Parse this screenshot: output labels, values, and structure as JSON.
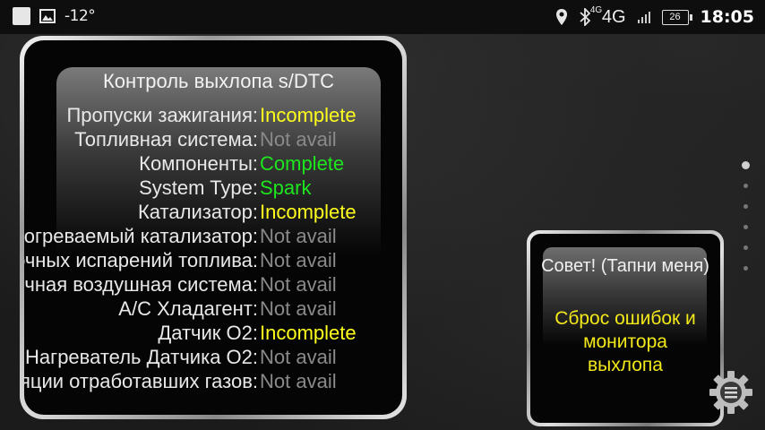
{
  "statusbar": {
    "temperature": "-12°",
    "network_small": "4G",
    "network": "4G",
    "battery": "26",
    "time": "18:05",
    "icons": [
      "square-icon",
      "image-icon",
      "location-icon",
      "bluetooth-icon",
      "signal-icon",
      "battery-icon"
    ]
  },
  "monitor": {
    "title": "Контроль выхлопа s/DTC",
    "rows": [
      {
        "label": "Пропуски зажигания:",
        "value": "Incomplete",
        "color": "#ffff1e"
      },
      {
        "label": "Топливная система:",
        "value": "Not avail",
        "color": "#8a8a8a"
      },
      {
        "label": "Компоненты:",
        "value": "Complete",
        "color": "#1ee61e"
      },
      {
        "label": "System Type:",
        "value": "Spark",
        "color": "#1ee61e"
      },
      {
        "label": "Катализатор:",
        "value": "Incomplete",
        "color": "#ffff1e"
      },
      {
        "label": "догреваемый катализатор:",
        "value": "Not avail",
        "color": "#8a8a8a"
      },
      {
        "label": "очных испарений топлива:",
        "value": "Not avail",
        "color": "#8a8a8a"
      },
      {
        "label": "ичная воздушная система:",
        "value": "Not avail",
        "color": "#8a8a8a"
      },
      {
        "label": "A/C Хладагент:",
        "value": "Not avail",
        "color": "#8a8a8a"
      },
      {
        "label": "Датчик О2:",
        "value": "Incomplete",
        "color": "#ffff1e"
      },
      {
        "label": "Нагреватель Датчика О2:",
        "value": "Not avail",
        "color": "#8a8a8a"
      },
      {
        "label": "яции отработавших газов:",
        "value": "Not avail",
        "color": "#8a8a8a"
      }
    ]
  },
  "tip": {
    "title": "Совет! (Тапни меня)",
    "body_line1": "Сброс ошибок и",
    "body_line2": "монитора",
    "body_line3": "выхлопа"
  },
  "pager": {
    "count": 6,
    "active_index": 0
  },
  "settings_icon": "gear-menu-icon"
}
